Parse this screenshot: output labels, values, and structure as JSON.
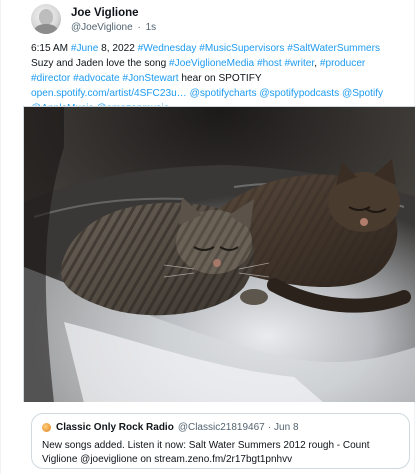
{
  "author": {
    "name": "Joe Viglione",
    "handle": "@JoeViglione",
    "separator": "·",
    "time": "1s"
  },
  "tweet": {
    "segments": [
      {
        "text": "6:15 AM ",
        "link": false
      },
      {
        "text": "#June",
        "link": true
      },
      {
        "text": " 8, 2022 ",
        "link": false
      },
      {
        "text": "#Wednesday",
        "link": true
      },
      {
        "text": " ",
        "link": false
      },
      {
        "text": "#MusicSupervisors",
        "link": true
      },
      {
        "text": " ",
        "link": false
      },
      {
        "text": "#SaltWaterSummers",
        "link": true
      },
      {
        "text": " Suzy and Jaden love the song ",
        "link": false
      },
      {
        "text": "#JoeViglioneMedia",
        "link": true
      },
      {
        "text": " ",
        "link": false
      },
      {
        "text": "#host",
        "link": true
      },
      {
        "text": " ",
        "link": false
      },
      {
        "text": "#writer",
        "link": true
      },
      {
        "text": ", ",
        "link": false
      },
      {
        "text": "#producer",
        "link": true
      },
      {
        "text": " ",
        "link": false
      },
      {
        "text": "#director",
        "link": true
      },
      {
        "text": " ",
        "link": false
      },
      {
        "text": "#advocate",
        "link": true
      },
      {
        "text": " ",
        "link": false
      },
      {
        "text": "#JonStewart",
        "link": true
      },
      {
        "text": " hear on SPOTIFY ",
        "link": false
      },
      {
        "text": "open.spotify.com/artist/4SFC23u…",
        "link": true
      },
      {
        "text": " ",
        "link": false
      },
      {
        "text": "@spotifycharts",
        "link": true
      },
      {
        "text": " ",
        "link": false
      },
      {
        "text": "@spotifypodcasts",
        "link": true
      },
      {
        "text": " ",
        "link": false
      },
      {
        "text": "@Spotify",
        "link": true
      },
      {
        "text": " ",
        "link": false
      },
      {
        "text": "@AppleMusic",
        "link": true
      },
      {
        "text": " ",
        "link": false
      },
      {
        "text": "@amazonmusic",
        "link": true
      }
    ]
  },
  "quote": {
    "name": "Classic Only Rock Radio",
    "handle": "@Classic21819467",
    "separator": "·",
    "date": "Jun 8",
    "text": "New songs added. Listen it now: Salt Water Summers 2012 rough - Count Viglione @joeviglione on stream.zeno.fm/2r17bgt1pnhvv"
  },
  "icons": {
    "avatar": "user-avatar",
    "quote_avatar": "station-avatar"
  }
}
